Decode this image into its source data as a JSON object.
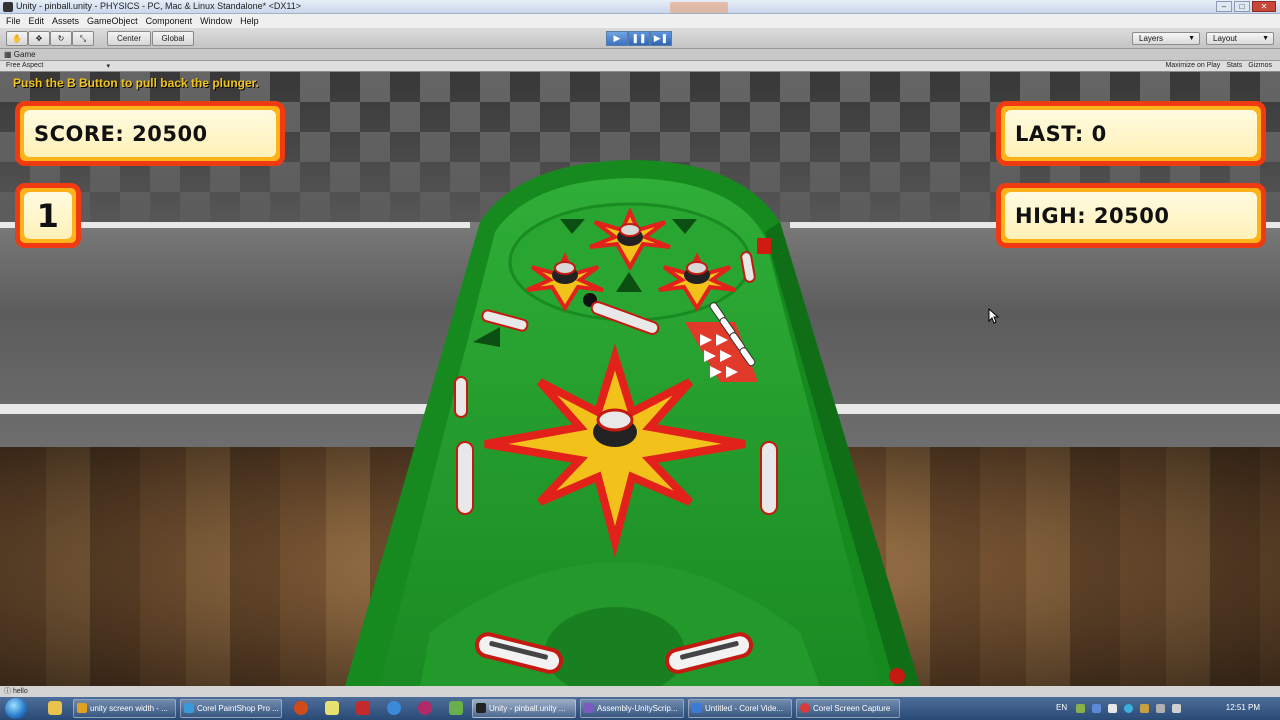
{
  "window": {
    "title": "Unity - pinball.unity - PHYSICS - PC, Mac & Linux Standalone* <DX11>",
    "min_label": "–",
    "max_label": "□",
    "close_label": "✕"
  },
  "menu": [
    "File",
    "Edit",
    "Assets",
    "GameObject",
    "Component",
    "Window",
    "Help"
  ],
  "toolbar": {
    "pivot_label": "Center",
    "space_label": "Global",
    "play_icon": "▶",
    "pause_icon": "❚❚",
    "step_icon": "▶❚",
    "layers_label": "Layers",
    "layout_label": "Layout"
  },
  "game_panel": {
    "tab_label": "Game",
    "aspect_label": "Free Aspect",
    "maximize_label": "Maximize on Play",
    "stats_label": "Stats",
    "gizmos_label": "Gizmos"
  },
  "hud": {
    "hint": "Push the B Button to pull back the plunger.",
    "score": "SCORE: 20500",
    "balls": "1",
    "last": "LAST: 0",
    "high": "HIGH: 20500"
  },
  "status_bar": {
    "message": "hello"
  },
  "taskbar": {
    "tasks": [
      {
        "label": "unity screen width - ...",
        "color": "#e0a020"
      },
      {
        "label": "Corel PaintShop Pro ...",
        "color": "#3a9ad9"
      },
      {
        "label": "Unity - pinball.unity ...",
        "color": "#222222"
      },
      {
        "label": "Assembly-UnityScrip...",
        "color": "#7a5cc0"
      },
      {
        "label": "Untitled - Corel Vide...",
        "color": "#3a7ad9"
      },
      {
        "label": "Corel Screen Capture",
        "color": "#d93a3a"
      }
    ],
    "language": "EN",
    "clock": "12:51 PM"
  },
  "colors": {
    "hud_border": "#f03b12",
    "hud_fill": "#fff1b8",
    "hint_text": "#f3c51b",
    "table_green": "#1f9a2a"
  }
}
